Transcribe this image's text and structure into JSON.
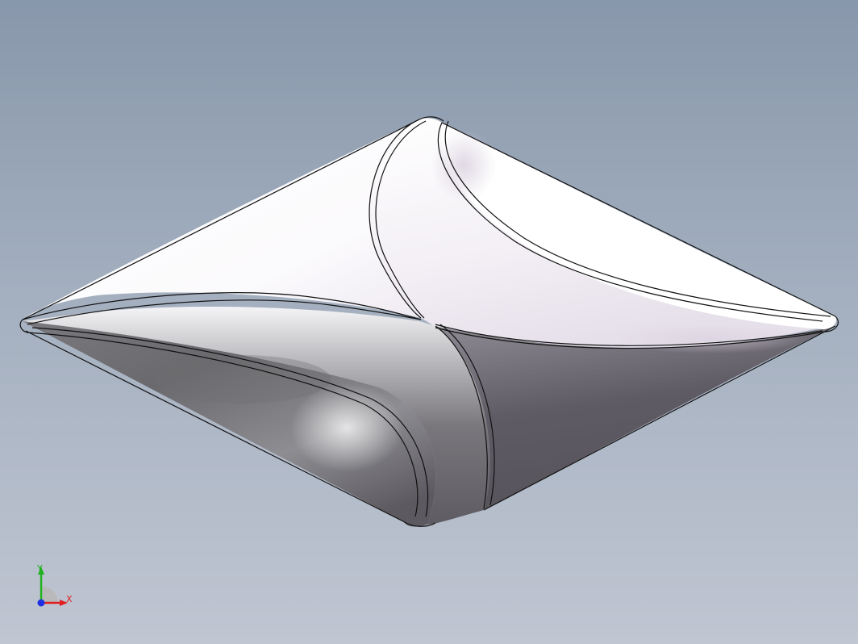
{
  "viewport": {
    "background_top": "#8897ab",
    "background_bottom": "#c0c6d2"
  },
  "model": {
    "description_icon": "3d-part-shaded-with-edges",
    "face_highlight_color": "#ffffff",
    "face_shadow_color": "#56535a",
    "edge_color": "#111111"
  },
  "triad": {
    "x_label": "X",
    "y_label": "Y",
    "x_color": "#e02020",
    "y_color": "#20b020",
    "z_color": "#2030e0"
  }
}
